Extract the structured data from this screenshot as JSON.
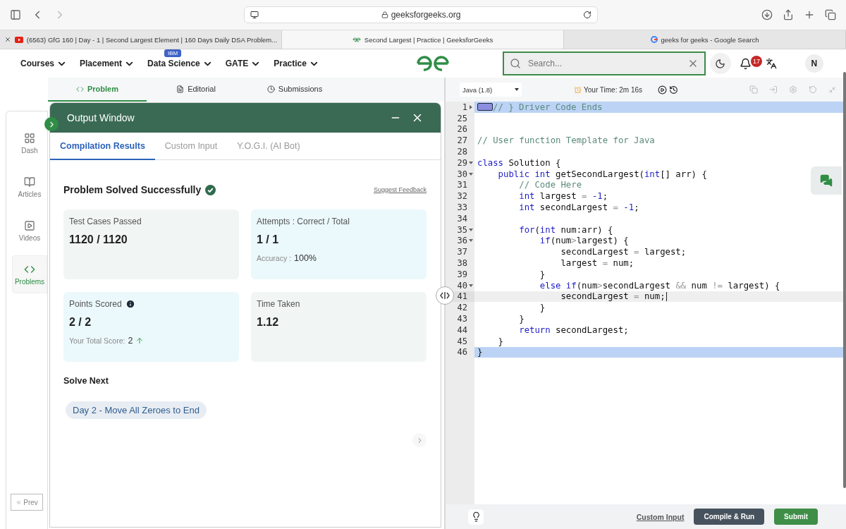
{
  "browser": {
    "url": "geeksforgeeks.org",
    "tabs": [
      {
        "title": "(6563) GfG 160 | Day - 1 | Second Largest Element | 160 Days Daily DSA Problem...",
        "selected": false,
        "kind": "video"
      },
      {
        "title": "Second Largest | Practice | GeeksforGeeks",
        "selected": true,
        "kind": "site"
      },
      {
        "title": "geeks for geeks  - Google Search",
        "selected": false,
        "kind": "search"
      }
    ]
  },
  "nav": {
    "items": [
      {
        "label": "Courses"
      },
      {
        "label": "Placement"
      },
      {
        "label": "Data Science",
        "badge": "IBM"
      },
      {
        "label": "GATE"
      },
      {
        "label": "Practice"
      }
    ],
    "search": {
      "placeholder": "Search..."
    },
    "notifications": "17",
    "avatar": "N"
  },
  "problem_tabs": [
    {
      "label": "Problem",
      "selected": true
    },
    {
      "label": "Editorial",
      "selected": false
    },
    {
      "label": "Submissions",
      "selected": false
    }
  ],
  "sidebar": {
    "items": [
      {
        "label": "Dash",
        "selected": false
      },
      {
        "label": "Articles",
        "selected": false
      },
      {
        "label": "Videos",
        "selected": false
      },
      {
        "label": "Problems",
        "selected": true
      }
    ],
    "prev": "Prev"
  },
  "output_window": {
    "title": "Output Window",
    "tabs": [
      {
        "label": "Compilation Results",
        "selected": true
      },
      {
        "label": "Custom Input",
        "selected": false
      },
      {
        "label": "Y.O.G.I. (AI Bot)",
        "selected": false
      }
    ],
    "status": "Problem Solved Successfully",
    "feedback_link": "Suggest Feedback",
    "cards": [
      {
        "title": "Test Cases Passed",
        "value": "1120 / 1120",
        "color": "#f1f6f4"
      },
      {
        "title": "Attempts : Correct / Total",
        "value": "1 / 1",
        "detail_label": "Accuracy :",
        "detail_value": "100%",
        "color": "#ebf8fc"
      },
      {
        "title": "Points Scored",
        "info": true,
        "value": "2 / 2",
        "detail_label": "Your Total Score:",
        "detail_value": "2",
        "trend_up": true,
        "color": "#ebf8fc"
      },
      {
        "title": "Time Taken",
        "value": "1.12",
        "color": "#f1f6f4"
      }
    ],
    "solve_next": {
      "heading": "Solve Next",
      "items": [
        "Day 2 - Move All Zeroes to End"
      ]
    }
  },
  "editor": {
    "language": "Java (1.8)",
    "timer": "Your Time: 2m 16s",
    "lines": [
      {
        "number": "1",
        "folded": true,
        "selected": true,
        "active": false,
        "tokens": [
          {
            "kind": "comment",
            "text": "// } Driver Code Ends"
          }
        ]
      },
      {
        "number": "25",
        "selected": false,
        "active": false
      },
      {
        "number": "26",
        "selected": false,
        "active": false
      },
      {
        "number": "27",
        "selected": false,
        "active": false,
        "tokens": [
          {
            "kind": "comment",
            "text": "// User function Template for Java"
          }
        ]
      },
      {
        "number": "28",
        "selected": false,
        "active": false
      },
      {
        "number": "29",
        "folded": false,
        "selected": false,
        "active": false,
        "tokens": [
          {
            "kind": "keyword",
            "text": "class"
          },
          {
            "kind": "plain",
            "text": " Solution {"
          }
        ]
      },
      {
        "number": "30",
        "folded": false,
        "selected": false,
        "active": false,
        "tokens": [
          {
            "kind": "keyword",
            "text": "    public"
          },
          {
            "kind": "keyword",
            "text": " int"
          },
          {
            "kind": "plain",
            "text": " getSecondLargest("
          },
          {
            "kind": "keyword",
            "text": "int"
          },
          {
            "kind": "plain",
            "text": "[] arr) {"
          }
        ]
      },
      {
        "number": "31",
        "selected": false,
        "active": false,
        "tokens": [
          {
            "kind": "comment",
            "text": "        // Code Here"
          }
        ]
      },
      {
        "number": "32",
        "selected": false,
        "active": false,
        "tokens": [
          {
            "kind": "keyword",
            "text": "        int"
          },
          {
            "kind": "plain",
            "text": " largest "
          },
          {
            "kind": "operator",
            "text": "="
          },
          {
            "kind": "number",
            "text": " -1"
          },
          {
            "kind": "plain",
            "text": ";"
          }
        ]
      },
      {
        "number": "33",
        "selected": false,
        "active": false,
        "tokens": [
          {
            "kind": "keyword",
            "text": "        int"
          },
          {
            "kind": "plain",
            "text": " secondLargest "
          },
          {
            "kind": "operator",
            "text": "="
          },
          {
            "kind": "number",
            "text": " -1"
          },
          {
            "kind": "plain",
            "text": ";"
          }
        ]
      },
      {
        "number": "34",
        "selected": false,
        "active": false
      },
      {
        "number": "35",
        "folded": false,
        "selected": false,
        "active": false,
        "tokens": [
          {
            "kind": "keyword",
            "text": "        for"
          },
          {
            "kind": "plain",
            "text": "("
          },
          {
            "kind": "keyword",
            "text": "int"
          },
          {
            "kind": "plain",
            "text": " num:arr) {"
          }
        ]
      },
      {
        "number": "36",
        "folded": false,
        "selected": false,
        "active": false,
        "tokens": [
          {
            "kind": "keyword",
            "text": "            if"
          },
          {
            "kind": "plain",
            "text": "(num"
          },
          {
            "kind": "operator",
            "text": ">"
          },
          {
            "kind": "plain",
            "text": "largest) {"
          }
        ]
      },
      {
        "number": "37",
        "selected": false,
        "active": false,
        "tokens": [
          {
            "kind": "plain",
            "text": "                secondLargest "
          },
          {
            "kind": "operator",
            "text": "="
          },
          {
            "kind": "plain",
            "text": " largest;"
          }
        ]
      },
      {
        "number": "38",
        "selected": false,
        "active": false,
        "tokens": [
          {
            "kind": "plain",
            "text": "                largest "
          },
          {
            "kind": "operator",
            "text": "="
          },
          {
            "kind": "plain",
            "text": " num;"
          }
        ]
      },
      {
        "number": "39",
        "selected": false,
        "active": false,
        "tokens": [
          {
            "kind": "plain",
            "text": "            }"
          }
        ]
      },
      {
        "number": "40",
        "folded": false,
        "selected": false,
        "active": false,
        "tokens": [
          {
            "kind": "keyword",
            "text": "            else"
          },
          {
            "kind": "keyword",
            "text": " if"
          },
          {
            "kind": "plain",
            "text": "(num"
          },
          {
            "kind": "operator",
            "text": ">"
          },
          {
            "kind": "plain",
            "text": "secondLargest "
          },
          {
            "kind": "operator",
            "text": "&&"
          },
          {
            "kind": "plain",
            "text": " num "
          },
          {
            "kind": "operator",
            "text": "!="
          },
          {
            "kind": "plain",
            "text": " largest) {"
          }
        ]
      },
      {
        "number": "41",
        "selected": false,
        "active": true,
        "tokens": [
          {
            "kind": "plain",
            "text": "                secondLargest "
          },
          {
            "kind": "operator",
            "text": "="
          },
          {
            "kind": "plain",
            "text": " num;"
          }
        ]
      },
      {
        "number": "42",
        "selected": false,
        "active": false,
        "tokens": [
          {
            "kind": "plain",
            "text": "            }"
          }
        ]
      },
      {
        "number": "43",
        "selected": false,
        "active": false,
        "tokens": [
          {
            "kind": "plain",
            "text": "        }"
          }
        ]
      },
      {
        "number": "44",
        "selected": false,
        "active": false,
        "tokens": [
          {
            "kind": "keyword",
            "text": "        return"
          },
          {
            "kind": "plain",
            "text": " secondLargest;"
          }
        ]
      },
      {
        "number": "45",
        "selected": false,
        "active": false,
        "tokens": [
          {
            "kind": "plain",
            "text": "    }"
          }
        ]
      },
      {
        "number": "46",
        "selected": true,
        "active": false,
        "tokens": [
          {
            "kind": "plain",
            "text": "}"
          }
        ]
      }
    ],
    "custom_input": "Custom Input",
    "buttons": [
      {
        "label": "Compile & Run",
        "kind": "secondary"
      },
      {
        "label": "Submit",
        "kind": "primary"
      }
    ]
  }
}
